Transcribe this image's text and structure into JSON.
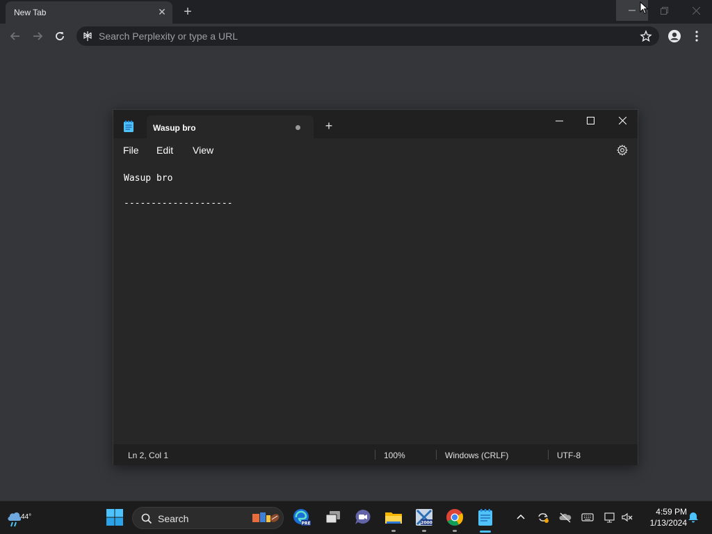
{
  "browser": {
    "tab_title": "New Tab",
    "omnibox_placeholder": "Search Perplexity or type a URL"
  },
  "notepad": {
    "tab_title": "Wasup bro",
    "menu": [
      "File",
      "Edit",
      "View"
    ],
    "lines": [
      "Wasup bro",
      "",
      "--------------------"
    ],
    "status": {
      "position": "Ln 2, Col 1",
      "zoom": "100%",
      "line_ending": "Windows (CRLF)",
      "encoding": "UTF-8"
    }
  },
  "taskbar": {
    "weather_temp": "44°",
    "search_label": "Search",
    "time": "4:59 PM",
    "date": "1/13/2024"
  },
  "colors": {
    "accent": "#4cc2ff",
    "browser_bg": "#35363a",
    "notepad_bg": "#272727"
  }
}
